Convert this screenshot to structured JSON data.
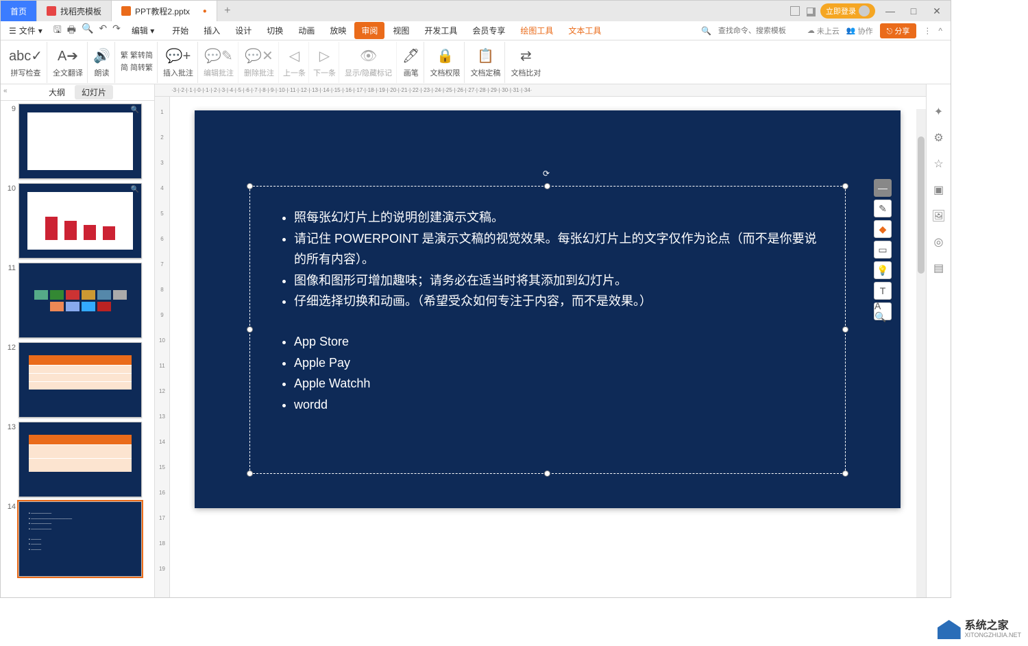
{
  "tabs": {
    "home": "首页",
    "template": "找稻壳模板",
    "doc": "PPT教程2.pptx"
  },
  "titlebar": {
    "login": "立即登录"
  },
  "menu": {
    "file": "文件",
    "edit": "编辑",
    "tabs": [
      "开始",
      "插入",
      "设计",
      "切换",
      "动画",
      "放映",
      "审阅",
      "视图",
      "开发工具",
      "会员专享"
    ],
    "active": "审阅",
    "extra": [
      "绘图工具",
      "文本工具"
    ],
    "search_ph": "查找命令、搜索模板",
    "cloud": "未上云",
    "collab": "协作",
    "share": "分享"
  },
  "ribbon": {
    "spellcheck": "拼写检查",
    "translate": "全文翻译",
    "read": "朗读",
    "fanjian1": "繁转简",
    "fanjian2": "简转繁",
    "insert_comment": "插入批注",
    "edit_comment": "编辑批注",
    "delete_comment": "删除批注",
    "prev": "上一条",
    "next": "下一条",
    "show_hide": "显示/隐藏标记",
    "brush": "画笔",
    "doc_perm": "文档权限",
    "doc_finalize": "文档定稿",
    "doc_compare": "文档比对"
  },
  "outline": {
    "outline": "大纲",
    "slides": "幻灯片"
  },
  "thumbs": {
    "nums": [
      "9",
      "10",
      "11",
      "12",
      "13",
      "14"
    ]
  },
  "slide_content": {
    "bullets1": [
      "照每张幻灯片上的说明创建演示文稿。",
      "请记住 POWERPOINT 是演示文稿的视觉效果。每张幻灯片上的文字仅作为论点（而不是你要说的所有内容）。",
      "图像和图形可增加趣味；请务必在适当时将其添加到幻灯片。",
      "仔细选择切换和动画。（希望受众如何专注于内容，而不是效果。）"
    ],
    "bullets2": [
      "App Store",
      "Apple Pay",
      "Apple Watchh",
      "wordd"
    ]
  },
  "watermark": {
    "cn": "系统之家",
    "en": "XITONGZHIJIA.NET"
  }
}
